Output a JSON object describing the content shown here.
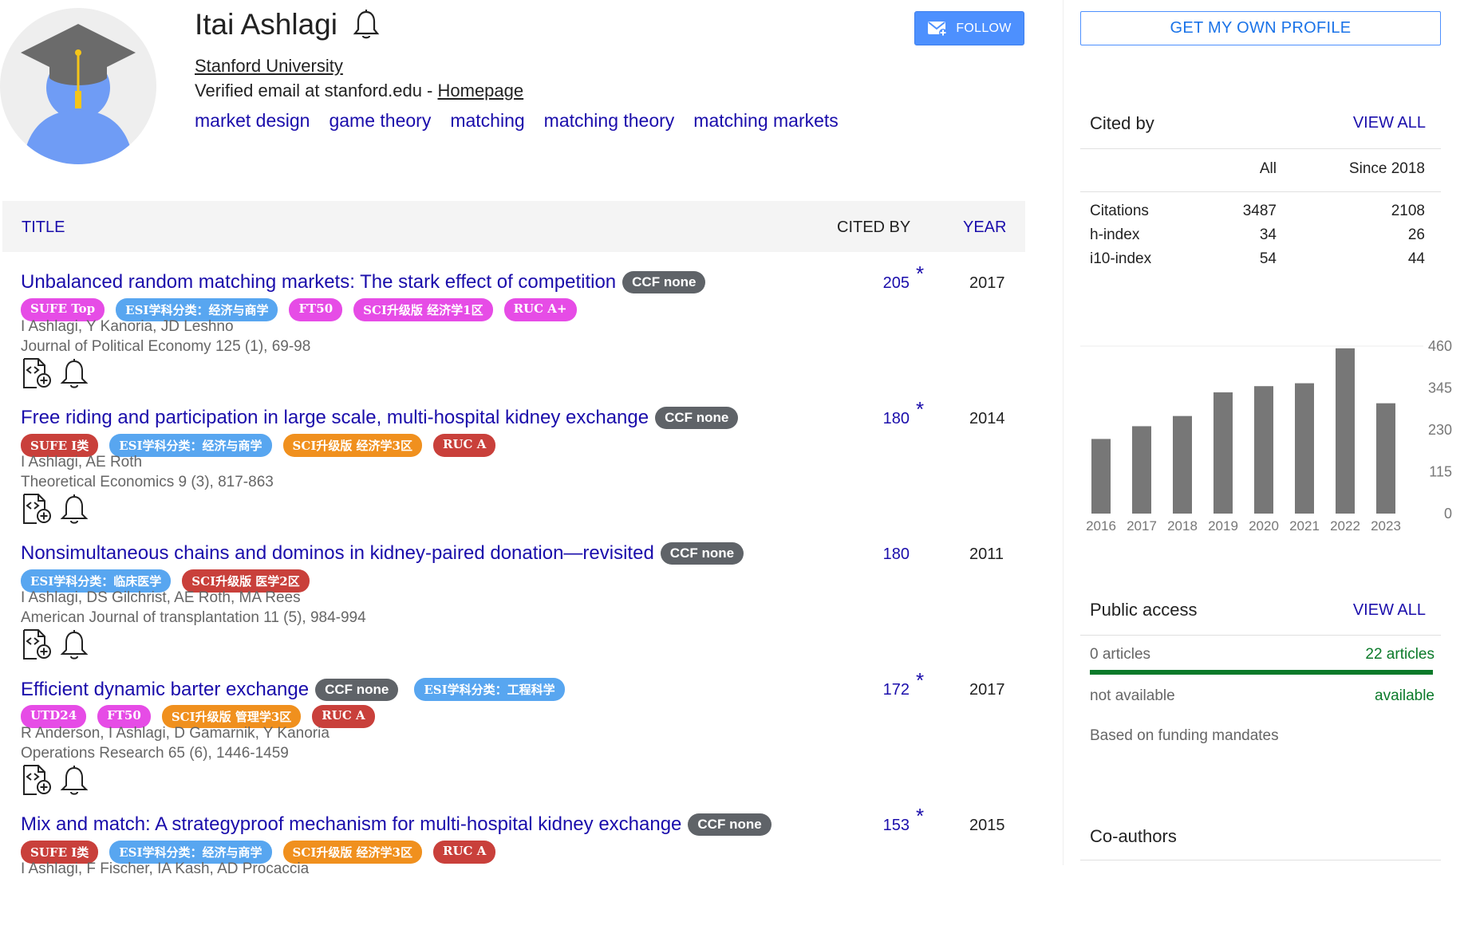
{
  "profile": {
    "name": "Itai Ashlagi",
    "affiliation": "Stanford University",
    "email_text": "Verified email at stanford.edu - ",
    "homepage_label": "Homepage",
    "interests": [
      "market design",
      "game theory",
      "matching",
      "matching theory",
      "matching markets"
    ],
    "follow_label": "FOLLOW"
  },
  "table": {
    "headers": {
      "title": "TITLE",
      "cited_by": "CITED BY",
      "year": "YEAR"
    },
    "star": "*",
    "rows": [
      {
        "title": "Unbalanced random matching markets: The stark effect of competition",
        "ccf": "CCF none",
        "badges": [
          {
            "text": "SUFE Top",
            "color": "#e64ce6"
          },
          {
            "text": "ESI学科分类：经济与商学",
            "color": "#58a6f0"
          },
          {
            "text": "FT50",
            "color": "#e64ce6"
          },
          {
            "text": "SCI升级版 经济学1区",
            "color": "#e64ce6"
          },
          {
            "text": "RUC A+",
            "color": "#e64ce6"
          }
        ],
        "authors": "I Ashlagi, Y Kanoria, JD Leshno",
        "venue": "Journal of Political Economy 125 (1), 69-98",
        "cited": "205",
        "starred": true,
        "year": "2017"
      },
      {
        "title": "Free riding and participation in large scale, multi-hospital kidney exchange",
        "ccf": "CCF none",
        "badges": [
          {
            "text": "SUFE I类",
            "color": "#c9403b"
          },
          {
            "text": "ESI学科分类：经济与商学",
            "color": "#58a6f0"
          },
          {
            "text": "SCI升级版 经济学3区",
            "color": "#f0901e"
          },
          {
            "text": "RUC A",
            "color": "#c9403b"
          }
        ],
        "authors": "I Ashlagi, AE Roth",
        "venue": "Theoretical Economics 9 (3), 817-863",
        "cited": "180",
        "starred": true,
        "year": "2014"
      },
      {
        "title": "Nonsimultaneous chains and dominos in kidney-paired donation—revisited",
        "ccf": "CCF none",
        "badges": [
          {
            "text": "ESI学科分类：临床医学",
            "color": "#58a6f0"
          },
          {
            "text": "SCI升级版 医学2区",
            "color": "#c9403b"
          }
        ],
        "authors": "I Ashlagi, DS Gilchrist, AE Roth, MA Rees",
        "venue": "American Journal of transplantation 11 (5), 984-994",
        "cited": "180",
        "starred": false,
        "year": "2011"
      },
      {
        "title": "Efficient dynamic barter exchange",
        "ccf": "CCF none",
        "title_badges": [
          {
            "text": "ESI学科分类：工程科学",
            "color": "#58a6f0"
          }
        ],
        "badges": [
          {
            "text": "UTD24",
            "color": "#e64ce6"
          },
          {
            "text": "FT50",
            "color": "#e64ce6"
          },
          {
            "text": "SCI升级版 管理学3区",
            "color": "#f0901e"
          },
          {
            "text": "RUC A",
            "color": "#c9403b"
          }
        ],
        "authors": "R Anderson, I Ashlagi, D Gamarnik, Y Kanoria",
        "venue": "Operations Research 65 (6), 1446-1459",
        "cited": "172",
        "starred": true,
        "year": "2017"
      },
      {
        "title": "Mix and match: A strategyproof mechanism for multi-hospital kidney exchange",
        "ccf": "CCF none",
        "badges": [
          {
            "text": "SUFE I类",
            "color": "#c9403b"
          },
          {
            "text": "ESI学科分类：经济与商学",
            "color": "#58a6f0"
          },
          {
            "text": "SCI升级版 经济学3区",
            "color": "#f0901e"
          },
          {
            "text": "RUC A",
            "color": "#c9403b"
          }
        ],
        "authors": "I Ashlagi, F Fischer, IA Kash, AD Procaccia",
        "venue": "",
        "cited": "153",
        "starred": true,
        "year": "2015"
      }
    ],
    "action_icons": [
      "add-to-library-icon",
      "bell-icon"
    ]
  },
  "sidebar": {
    "own_profile_label": "GET MY OWN PROFILE",
    "cited_by": {
      "title": "Cited by",
      "view_all": "VIEW ALL",
      "columns": [
        "All",
        "Since 2018"
      ],
      "rows": [
        {
          "label": "Citations",
          "all": "3487",
          "since": "2108"
        },
        {
          "label": "h-index",
          "all": "34",
          "since": "26"
        },
        {
          "label": "i10-index",
          "all": "54",
          "since": "44"
        }
      ]
    },
    "public_access": {
      "title": "Public access",
      "view_all": "VIEW ALL",
      "not_available_count": "0 articles",
      "available_count": "22 articles",
      "not_available_label": "not available",
      "available_label": "available",
      "note": "Based on funding mandates",
      "available_fraction": 1.0
    },
    "coauthors_title": "Co-authors"
  },
  "chart_data": {
    "type": "bar",
    "categories": [
      "2016",
      "2017",
      "2018",
      "2019",
      "2020",
      "2021",
      "2022",
      "2023"
    ],
    "values": [
      205,
      240,
      268,
      333,
      350,
      358,
      454,
      303
    ],
    "ylim": [
      0,
      460
    ],
    "yticks": [
      "0",
      "115",
      "230",
      "345",
      "460"
    ],
    "bar_color": "#777777",
    "grid": false
  },
  "colors": {
    "link": "#1a0dab",
    "follow_button": "#4d90fe",
    "public_access_bar": "#0b7a2a"
  }
}
